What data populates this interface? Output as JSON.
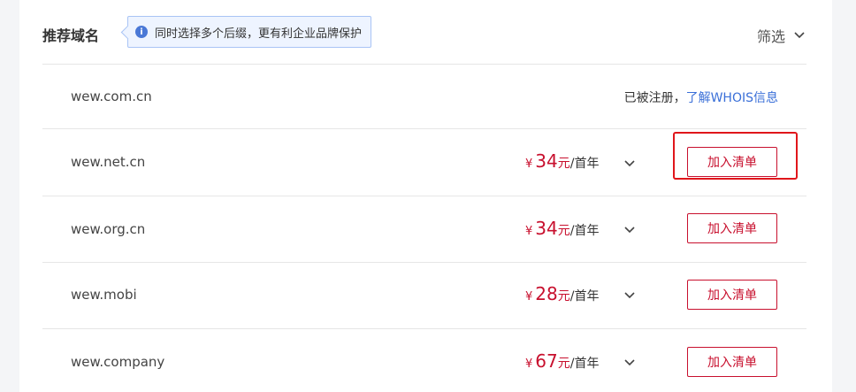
{
  "header": {
    "title": "推荐域名",
    "tip_icon": "i",
    "tip_text": "同时选择多个后缀，更有利企业品牌保护",
    "filter_label": "筛选"
  },
  "registered_row": {
    "domain": "wew.com.cn",
    "status": "已被注册，",
    "whois_link": "了解WHOIS信息"
  },
  "rows": [
    {
      "domain": "wew.net.cn",
      "currency": "¥",
      "price": "34",
      "unit_yuan": "元",
      "unit_rest": "/首年",
      "button": "加入清单"
    },
    {
      "domain": "wew.org.cn",
      "currency": "¥",
      "price": "34",
      "unit_yuan": "元",
      "unit_rest": "/首年",
      "button": "加入清单"
    },
    {
      "domain": "wew.mobi",
      "currency": "¥",
      "price": "28",
      "unit_yuan": "元",
      "unit_rest": "/首年",
      "button": "加入清单"
    },
    {
      "domain": "wew.company",
      "currency": "¥",
      "price": "67",
      "unit_yuan": "元",
      "unit_rest": "/首年",
      "button": "加入清单"
    }
  ],
  "colors": {
    "accent_red": "#c8102e",
    "link_blue": "#3a6fd8",
    "highlight_red": "#e0161b"
  }
}
